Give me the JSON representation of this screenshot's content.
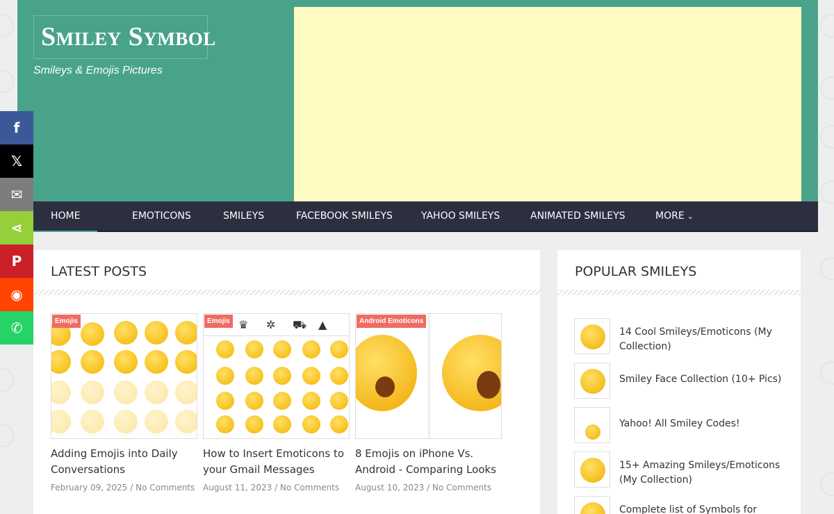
{
  "site": {
    "logo": "Smiley Symbol",
    "tagline": "Smileys & Emojis Pictures"
  },
  "nav": [
    {
      "label": "HOME",
      "active": true
    },
    {
      "label": "EMOTICONS"
    },
    {
      "label": "SMILEYS"
    },
    {
      "label": "FACEBOOK SMILEYS"
    },
    {
      "label": "YAHOO SMILEYS"
    },
    {
      "label": "ANIMATED SMILEYS"
    },
    {
      "label": "MORE",
      "icon": "chevron-down-icon"
    }
  ],
  "latest": {
    "title": "LATEST POSTS",
    "posts": [
      {
        "badge": "Emojis",
        "title": "Adding Emojis into Daily Conversations",
        "date": "February 09, 2025",
        "comments": "No Comments"
      },
      {
        "badge": "Emojis",
        "title": "How to Insert Emoticons to your Gmail Messages",
        "date": "August 11, 2023",
        "comments": "No Comments"
      },
      {
        "badge": "Android Emoticons",
        "title": "8 Emojis on iPhone Vs. Android - Comparing Looks",
        "date": "August 10, 2023",
        "comments": "No Comments"
      }
    ]
  },
  "popular": {
    "title": "POPULAR SMILEYS",
    "items": [
      {
        "label": "14 Cool Smileys/Emoticons (My Collection)"
      },
      {
        "label": "Smiley Face Collection (10+ Pics)"
      },
      {
        "label": "Yahoo! All Smiley Codes!"
      },
      {
        "label": "15+ Amazing Smileys/Emoticons (My Collection)"
      },
      {
        "label": "Complete list of Symbols for"
      }
    ]
  },
  "share": [
    {
      "name": "facebook-icon",
      "glyph": "f",
      "color": "#3b5998"
    },
    {
      "name": "x-icon",
      "glyph": "𝕏",
      "color": "#000000"
    },
    {
      "name": "email-icon",
      "glyph": "✉",
      "color": "#7d7d7d"
    },
    {
      "name": "share-icon",
      "glyph": "⋖",
      "color": "#95d03a"
    },
    {
      "name": "pinterest-icon",
      "glyph": "P",
      "color": "#cb2027"
    },
    {
      "name": "reddit-icon",
      "glyph": "◉",
      "color": "#ff4500"
    },
    {
      "name": "whatsapp-icon",
      "glyph": "✆",
      "color": "#25d366"
    }
  ],
  "colors": {
    "header": "#48a38a",
    "nav": "#2b2f3f",
    "ad": "#fff9c2",
    "badge": "#f06b63"
  }
}
